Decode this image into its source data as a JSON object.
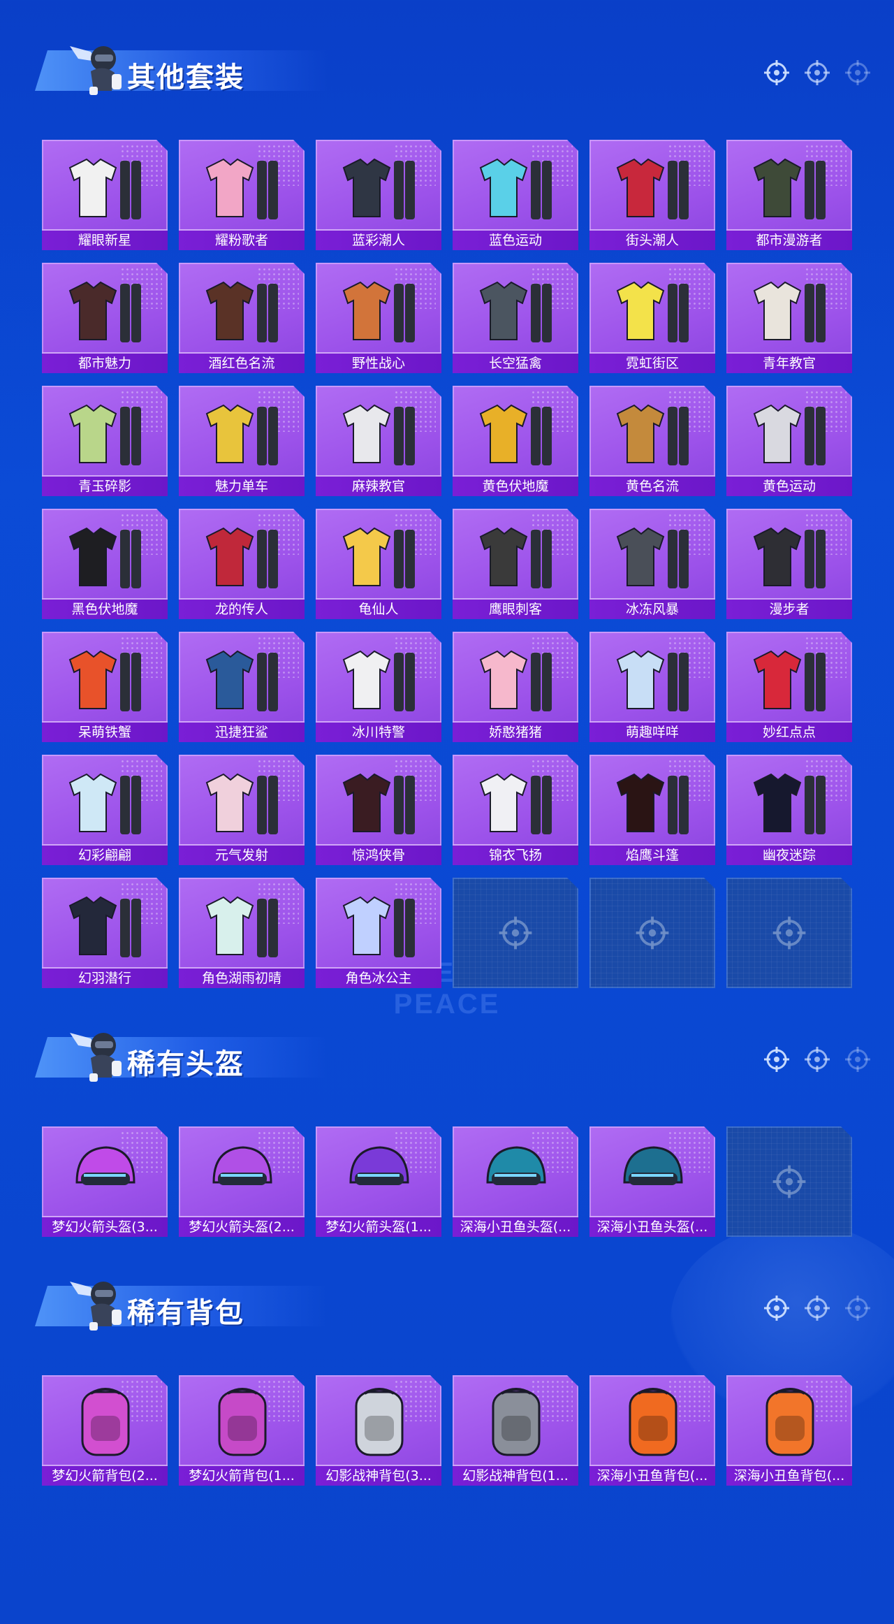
{
  "watermark": "GAME FOR PEACE",
  "sections": [
    {
      "title": "其他套装",
      "items": [
        "耀眼新星",
        "耀粉歌者",
        "蓝彩潮人",
        "蓝色运动",
        "街头潮人",
        "都市漫游者",
        "都市魅力",
        "酒红色名流",
        "野性战心",
        "长空猛禽",
        "霓虹街区",
        "青年教官",
        "青玉碎影",
        "魅力单车",
        "麻辣教官",
        "黄色伏地魔",
        "黄色名流",
        "黄色运动",
        "黑色伏地魔",
        "龙的传人",
        "龟仙人",
        "鹰眼刺客",
        "冰冻风暴",
        "漫步者",
        "呆萌铁蟹",
        "迅捷狂鲨",
        "冰川特警",
        "娇憨猪猪",
        "萌趣咩咩",
        "妙红点点",
        "幻彩翩翩",
        "元气发射",
        "惊鸿侠骨",
        "锦衣飞扬",
        "焰鹰斗篷",
        "幽夜迷踪",
        "幻羽潜行",
        "角色湖雨初晴",
        "角色冰公主"
      ],
      "empty_slots": 3
    },
    {
      "title": "稀有头盔",
      "items": [
        "梦幻火箭头盔(3...",
        "梦幻火箭头盔(2...",
        "梦幻火箭头盔(1...",
        "深海小丑鱼头盔(...",
        "深海小丑鱼头盔(..."
      ],
      "empty_slots": 1
    },
    {
      "title": "稀有背包",
      "items": [
        "梦幻火箭背包(2...",
        "梦幻火箭背包(1...",
        "幻影战神背包(3...",
        "幻影战神背包(1...",
        "深海小丑鱼背包(...",
        "深海小丑鱼背包(..."
      ],
      "empty_slots": 0
    }
  ],
  "icons": {
    "header_dots": "crosshair-icon",
    "empty_slot": "crosshair-icon",
    "mascot": "soldier-mascot-icon"
  },
  "colors": {
    "background": "#0a48d3",
    "card": "#9c52ea",
    "label_bar": "#7a1fd6",
    "empty_card": "#1a4aa8"
  }
}
